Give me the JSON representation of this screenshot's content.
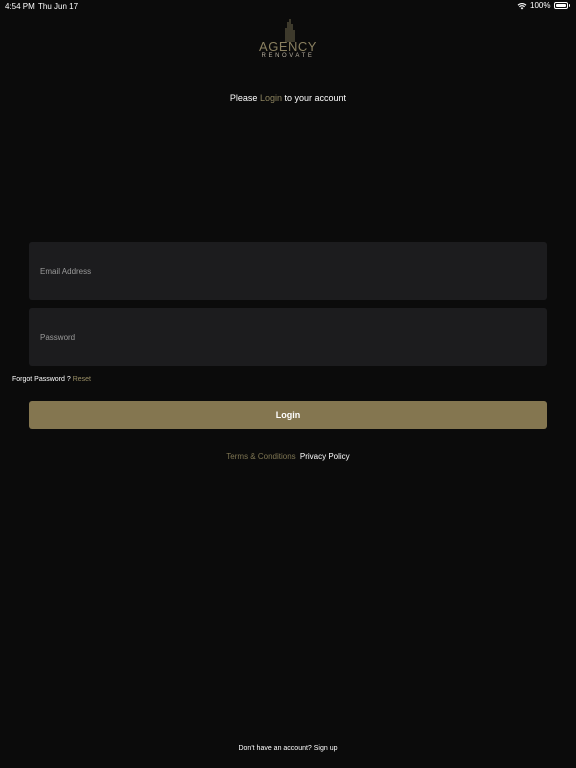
{
  "status_bar": {
    "time": "4:54 PM",
    "date": "Thu Jun 17",
    "battery": "100%",
    "wifi_icon": "wifi-icon",
    "battery_icon": "battery-icon"
  },
  "logo": {
    "title": "AGENCY",
    "subtitle": "RENOVATE"
  },
  "heading": {
    "prefix": "Please",
    "accent": "Login",
    "suffix": "to your account"
  },
  "form": {
    "email_placeholder": "Email Address",
    "password_placeholder": "Password",
    "forgot_label": "Forgot Password ?",
    "reset_label": "Reset",
    "login_label": "Login"
  },
  "legal": {
    "terms_label": "Terms & Conditions",
    "privacy_label": "Privacy Policy"
  },
  "footer": {
    "signup_label": "Don't have an account? Sign up"
  },
  "colors": {
    "background": "#0b0b0b",
    "accent": "#847650",
    "input_bg": "#1c1c1e"
  }
}
